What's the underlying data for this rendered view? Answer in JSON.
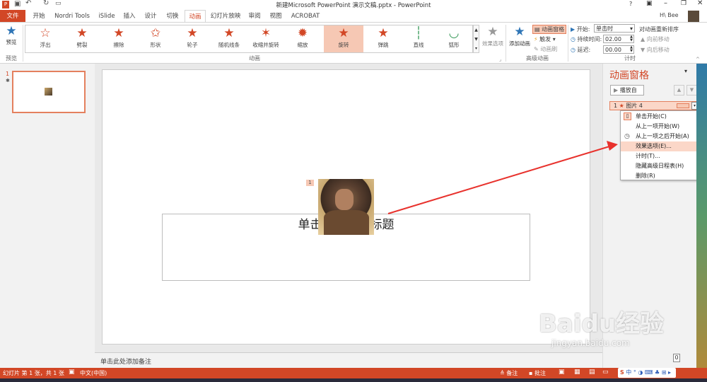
{
  "window": {
    "title": "新建Microsoft PowerPoint 演示文稿.pptx - PowerPoint",
    "user": "H\\ Bee",
    "help": "?"
  },
  "tabs": [
    "文件",
    "开始",
    "Nordri Tools",
    "iSlide",
    "插入",
    "设计",
    "切换",
    "动画",
    "幻灯片放映",
    "审阅",
    "视图",
    "ACROBAT"
  ],
  "ribbon": {
    "preview_label": "预览",
    "preview_group": "预览",
    "animations": [
      "浮出",
      "劈裂",
      "擦除",
      "形状",
      "轮子",
      "随机线条",
      "收缩并旋转",
      "缩放",
      "旋转",
      "弹跳",
      "直线",
      "弧形"
    ],
    "anim_group": "动画",
    "effect_options": "效果选项",
    "add_animation": "添加动画",
    "anim_pane_btn": "动画窗格",
    "trigger": "触发",
    "anim_painter": "动画刷",
    "adv_group": "高级动画",
    "start_label": "开始:",
    "start_value": "单击时",
    "duration_label": "持续时间:",
    "duration_value": "02.00",
    "delay_label": "延迟:",
    "delay_value": "00.00",
    "reorder_label": "对动画重新排序",
    "move_earlier": "向前移动",
    "move_later": "向后移动",
    "timing_group": "计时"
  },
  "slides": {
    "number": "1"
  },
  "slide": {
    "title_placeholder": "单击此处添加标题",
    "anim_tag": "1"
  },
  "notes_placeholder": "单击此处添加备注",
  "anim_pane": {
    "title": "动画窗格",
    "play_btn": "播放自",
    "item_index": "1",
    "item_label": "图片 4"
  },
  "context_menu": [
    "单击开始(C)",
    "从上一项开始(W)",
    "从上一项之后开始(A)",
    "效果选项(E)...",
    "计时(T)...",
    "隐藏高级日程表(H)",
    "删除(R)"
  ],
  "status": {
    "slide_info": "幻灯片 第 1 张，共 1 张",
    "language": "中文(中国)",
    "notes": "备注",
    "comments": "批注",
    "zoom": "0"
  },
  "watermark": {
    "brand": "Baidu经验",
    "url": "jingyan.baidu.com"
  },
  "colors": {
    "accent": "#d24726",
    "selected": "#f6c8b4",
    "arrow": "#e8322d"
  }
}
